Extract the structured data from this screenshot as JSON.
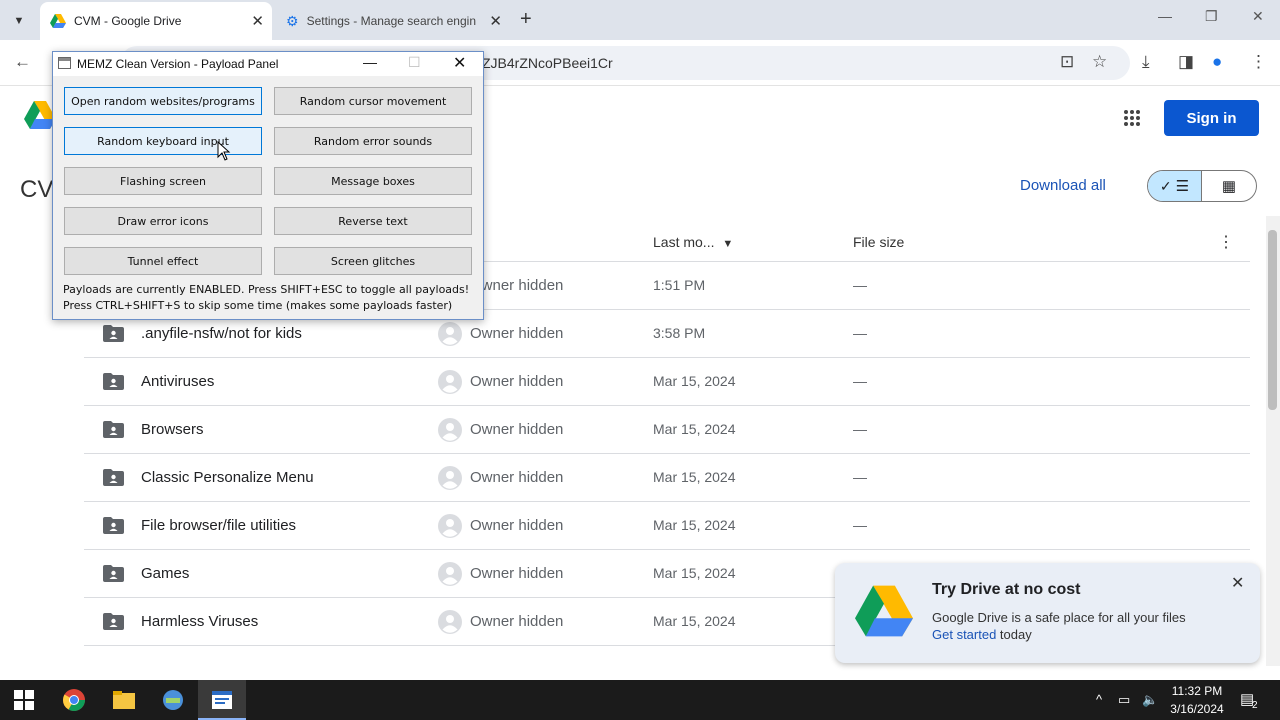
{
  "browser": {
    "tabs": [
      {
        "title": "CVM - Google Drive",
        "active": true
      },
      {
        "title": "Settings - Manage search engin",
        "active": false
      }
    ],
    "url_visible": "ZJB4rZNcoPBeei1Cr"
  },
  "drive": {
    "sign_in": "Sign in",
    "folder_title": "CV",
    "download_all": "Download all",
    "columns": {
      "modified": "Last mo...",
      "size": "File size"
    },
    "rows": [
      {
        "name": "",
        "owner": "Owner hidden",
        "modified": "1:51 PM",
        "size": "—"
      },
      {
        "name": ".anyfile-nsfw/not for kids",
        "owner": "Owner hidden",
        "modified": "3:58 PM",
        "size": "—"
      },
      {
        "name": "Antiviruses",
        "owner": "Owner hidden",
        "modified": "Mar 15, 2024",
        "size": "—"
      },
      {
        "name": "Browsers",
        "owner": "Owner hidden",
        "modified": "Mar 15, 2024",
        "size": "—"
      },
      {
        "name": "Classic Personalize Menu",
        "owner": "Owner hidden",
        "modified": "Mar 15, 2024",
        "size": "—"
      },
      {
        "name": "File browser/file utilities",
        "owner": "Owner hidden",
        "modified": "Mar 15, 2024",
        "size": "—"
      },
      {
        "name": "Games",
        "owner": "Owner hidden",
        "modified": "Mar 15, 2024",
        "size": "—"
      },
      {
        "name": "Harmless Viruses",
        "owner": "Owner hidden",
        "modified": "Mar 15, 2024",
        "size": "—"
      }
    ]
  },
  "promo": {
    "title": "Try Drive at no cost",
    "body": "Google Drive is a safe place for all your files",
    "link": "Get started",
    "link_suffix": " today"
  },
  "memz": {
    "title": "MEMZ Clean Version - Payload Panel",
    "buttons": [
      "Open random websites/programs",
      "Random cursor movement",
      "Random keyboard input",
      "Random error sounds",
      "Flashing screen",
      "Message boxes",
      "Draw error icons",
      "Reverse text",
      "Tunnel effect",
      "Screen glitches"
    ],
    "status_line1": "Payloads are currently ENABLED. Press SHIFT+ESC to toggle all payloads!",
    "status_line2": "Press CTRL+SHIFT+S to skip some time (makes some payloads faster)"
  },
  "taskbar": {
    "time": "11:32 PM",
    "date": "3/16/2024",
    "notification_count": "2"
  },
  "colors": {
    "accent": "#0b57d0",
    "toggle_on": "#c2e7ff",
    "memz_border": "#6b8fc7"
  }
}
